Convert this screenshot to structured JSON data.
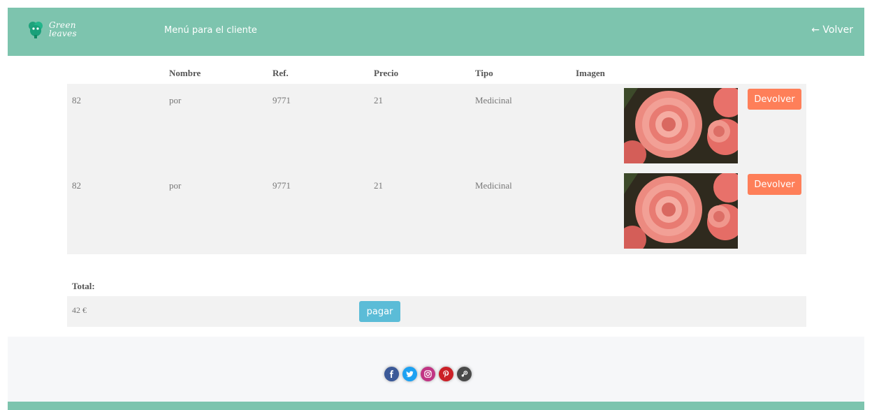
{
  "header": {
    "logo_line1": "Green",
    "logo_line2": "leaves",
    "title": "Menú para el cliente",
    "back_label": "← Volver"
  },
  "table": {
    "columns": [
      "",
      "Nombre",
      "Ref.",
      "Precio",
      "Tipo",
      "Imagen"
    ],
    "rows": [
      {
        "id": "82",
        "nombre": "por",
        "ref": "9771",
        "precio": "21",
        "tipo": "Medicinal",
        "action": "Devolver"
      },
      {
        "id": "82",
        "nombre": "por",
        "ref": "9771",
        "precio": "21",
        "tipo": "Medicinal",
        "action": "Devolver"
      }
    ]
  },
  "total": {
    "label": "Total:",
    "value": "42 €",
    "pay_label": "pagar"
  },
  "footer": {
    "social": [
      "facebook-icon",
      "twitter-icon",
      "instagram-icon",
      "pinterest-icon",
      "steam-icon"
    ]
  },
  "colors": {
    "header_bg": "#7dc4ae",
    "return_button": "#fe7f59",
    "pay_button": "#5bbcd7"
  }
}
